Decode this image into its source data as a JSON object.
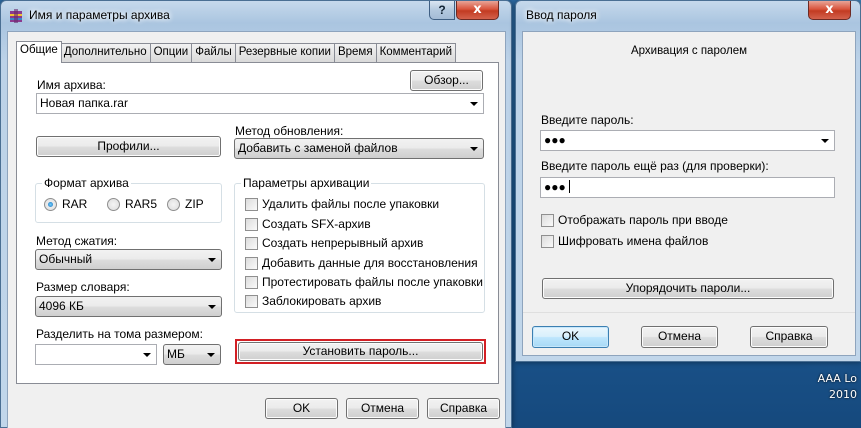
{
  "desktop": {
    "corner_text_1": "AAA Lo",
    "corner_text_2": "2010"
  },
  "main_window": {
    "title": "Имя и параметры архива",
    "tabs": [
      "Общие",
      "Дополнительно",
      "Опции",
      "Файлы",
      "Резервные копии",
      "Время",
      "Комментарий"
    ],
    "active_tab": "Общие",
    "archive_name_label": "Имя архива:",
    "archive_name_value": "Новая папка.rar",
    "browse_button": "Обзор...",
    "profiles_button": "Профили...",
    "update_method_label": "Метод обновления:",
    "update_method_value": "Добавить с заменой файлов",
    "archive_format": {
      "title": "Формат архива",
      "options": [
        {
          "label": "RAR",
          "selected": true
        },
        {
          "label": "RAR5",
          "selected": false
        },
        {
          "label": "ZIP",
          "selected": false
        }
      ]
    },
    "compression_label": "Метод сжатия:",
    "compression_value": "Обычный",
    "dictionary_label": "Размер словаря:",
    "dictionary_value": "4096 КБ",
    "split_label": "Разделить на тома размером:",
    "split_value": "",
    "split_unit": "МБ",
    "archiving_options": {
      "title": "Параметры архивации",
      "items": [
        {
          "label": "Удалить файлы после упаковки",
          "checked": false
        },
        {
          "label": "Создать SFX-архив",
          "checked": false
        },
        {
          "label": "Создать непрерывный архив",
          "checked": false
        },
        {
          "label": "Добавить данные для восстановления",
          "checked": false
        },
        {
          "label": "Протестировать файлы после упаковки",
          "checked": false
        },
        {
          "label": "Заблокировать архив",
          "checked": false
        }
      ]
    },
    "set_password_button": "Установить пароль...",
    "ok_button": "OK",
    "cancel_button": "Отмена",
    "help_button": "Справка",
    "help_title_button": "?",
    "close_title_button": "x"
  },
  "password_window": {
    "title": "Ввод пароля",
    "heading": "Архивация с паролем",
    "password_label": "Введите пароль:",
    "password_value": "●●●",
    "confirm_label": "Введите пароль ещё раз (для проверки):",
    "confirm_value": "●●●",
    "show_password": {
      "label": "Отображать пароль при вводе",
      "checked": false
    },
    "encrypt_names": {
      "label": "Шифровать имена файлов",
      "checked": false
    },
    "organize_button": "Упорядочить пароли...",
    "ok_button": "OK",
    "cancel_button": "Отмена",
    "help_button": "Справка",
    "close_title_button": "x"
  },
  "colors": {
    "highlight_frame": "#d21f24",
    "desktop": "#1f5f99"
  }
}
